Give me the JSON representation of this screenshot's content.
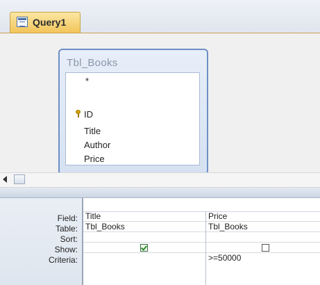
{
  "tab": {
    "label": "Query1"
  },
  "table": {
    "name": "Tbl_Books",
    "fields": [
      "*",
      "ID",
      "Title",
      "Author",
      "Price"
    ],
    "primary_key": "ID"
  },
  "grid": {
    "row_labels": {
      "field": "Field:",
      "table": "Table:",
      "sort": "Sort:",
      "show": "Show:",
      "criteria": "Criteria:"
    },
    "columns": [
      {
        "field": "Title",
        "table": "Tbl_Books",
        "sort": "",
        "show": true,
        "criteria": ""
      },
      {
        "field": "Price",
        "table": "Tbl_Books",
        "sort": "",
        "show": false,
        "criteria": ">=50000"
      }
    ]
  },
  "icons": {
    "tab": "query-icon",
    "key": "primary-key-icon",
    "scroll_left": "scroll-left-arrow-icon"
  },
  "colors": {
    "tab_active": "#f2c45a",
    "table_box_border": "#6d8fc4",
    "key": "#d9a400",
    "checkbox_check": "#2f8a2f"
  }
}
